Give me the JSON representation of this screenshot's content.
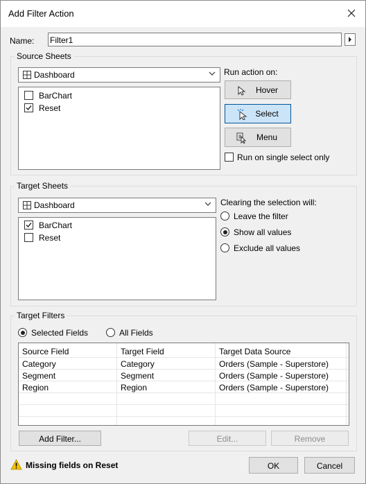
{
  "window": {
    "title": "Add Filter Action"
  },
  "name_field": {
    "label": "Name:",
    "value": "Filter1"
  },
  "source": {
    "group_title": "Source Sheets",
    "dropdown_value": "Dashboard",
    "sheets": [
      {
        "label": "BarChart",
        "checked": false
      },
      {
        "label": "Reset",
        "checked": true
      }
    ],
    "run_action_label": "Run action on:",
    "actions": [
      {
        "label": "Hover",
        "selected": false
      },
      {
        "label": "Select",
        "selected": true
      },
      {
        "label": "Menu",
        "selected": false
      }
    ],
    "single_select_label": "Run on single select only",
    "single_select_checked": false
  },
  "target": {
    "group_title": "Target Sheets",
    "dropdown_value": "Dashboard",
    "sheets": [
      {
        "label": "BarChart",
        "checked": true
      },
      {
        "label": "Reset",
        "checked": false
      }
    ],
    "clearing_label": "Clearing the selection will:",
    "clearing_options": [
      {
        "label": "Leave the filter",
        "selected": false
      },
      {
        "label": "Show all values",
        "selected": true
      },
      {
        "label": "Exclude all values",
        "selected": false
      }
    ]
  },
  "filters": {
    "group_title": "Target Filters",
    "scope_options": [
      {
        "label": "Selected Fields",
        "selected": true
      },
      {
        "label": "All Fields",
        "selected": false
      }
    ],
    "columns": [
      "Source Field",
      "Target Field",
      "Target Data Source"
    ],
    "rows": [
      [
        "Category",
        "Category",
        "Orders (Sample - Superstore)"
      ],
      [
        "Segment",
        "Segment",
        "Orders (Sample - Superstore)"
      ],
      [
        "Region",
        "Region",
        "Orders (Sample - Superstore)"
      ]
    ],
    "add_label": "Add Filter...",
    "edit_label": "Edit...",
    "remove_label": "Remove"
  },
  "footer": {
    "warning": "Missing fields on Reset",
    "ok_label": "OK",
    "cancel_label": "Cancel"
  },
  "colors": {
    "selected_button": "#cce4f7",
    "selected_border": "#005499",
    "warning_yellow": "#f5c400"
  }
}
